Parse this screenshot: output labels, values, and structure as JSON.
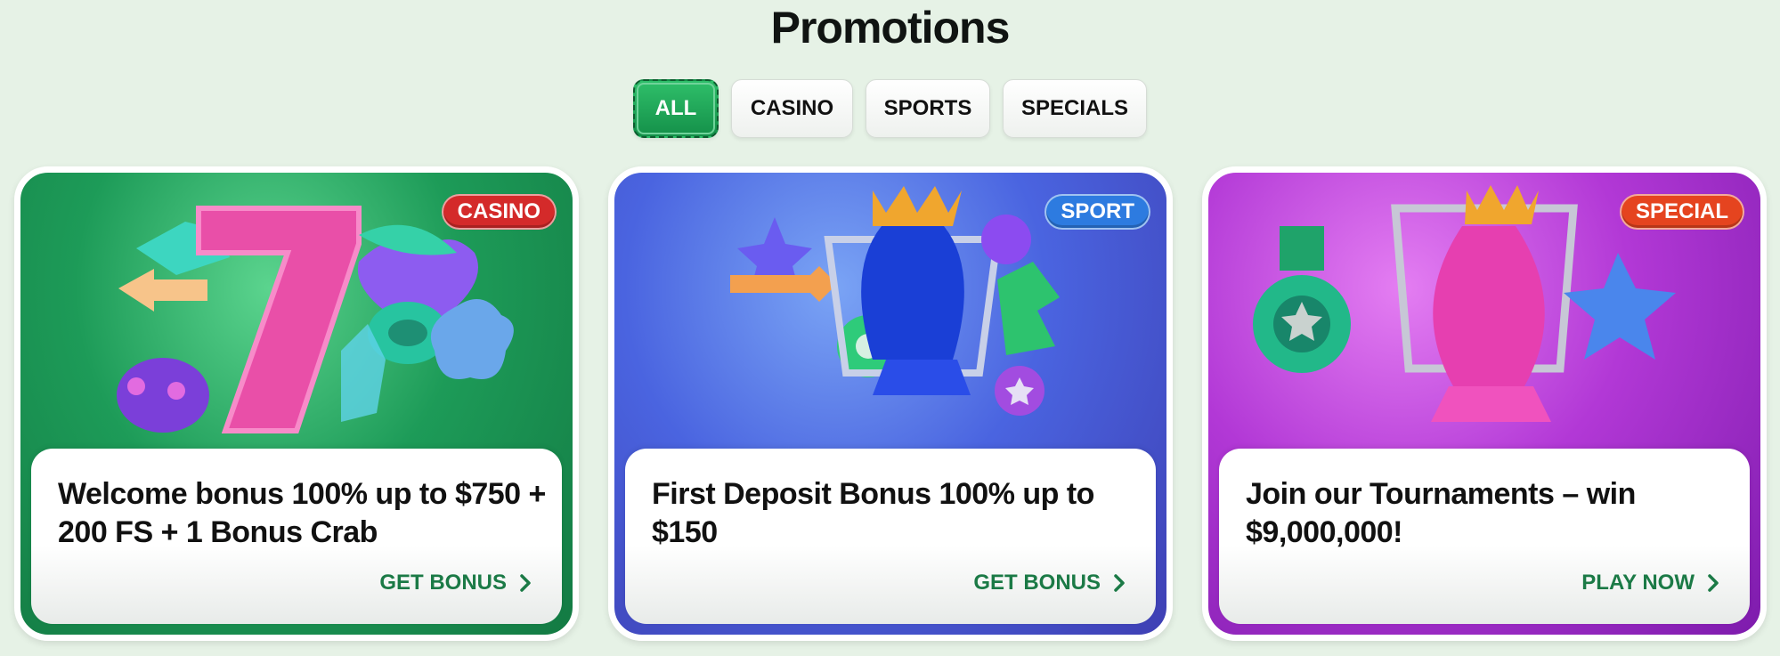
{
  "page": {
    "title": "Promotions"
  },
  "filters": [
    {
      "label": "ALL",
      "active": true
    },
    {
      "label": "CASINO",
      "active": false
    },
    {
      "label": "SPORTS",
      "active": false
    },
    {
      "label": "SPECIALS",
      "active": false
    }
  ],
  "cards": [
    {
      "tag": "CASINO",
      "tag_color": "#d42a2a",
      "title": "Welcome bonus 100% up to $750 + 200 FS + 1 Bonus Crab",
      "cta": "GET BONUS",
      "icon": "slot-symbols-illustration"
    },
    {
      "tag": "SPORT",
      "tag_color": "#2d7be0",
      "title": "First Deposit Bonus 100% up to $150",
      "cta": "GET BONUS",
      "icon": "trophy-illustration"
    },
    {
      "tag": "SPECIAL",
      "tag_color": "#e5441f",
      "title": "Join our Tournaments – win $9,000,000!",
      "cta": "PLAY NOW",
      "icon": "tournament-illustration"
    }
  ],
  "colors": {
    "background": "#e6f2e6",
    "accent": "#1b7a46",
    "active_filter": "#1fa457"
  }
}
